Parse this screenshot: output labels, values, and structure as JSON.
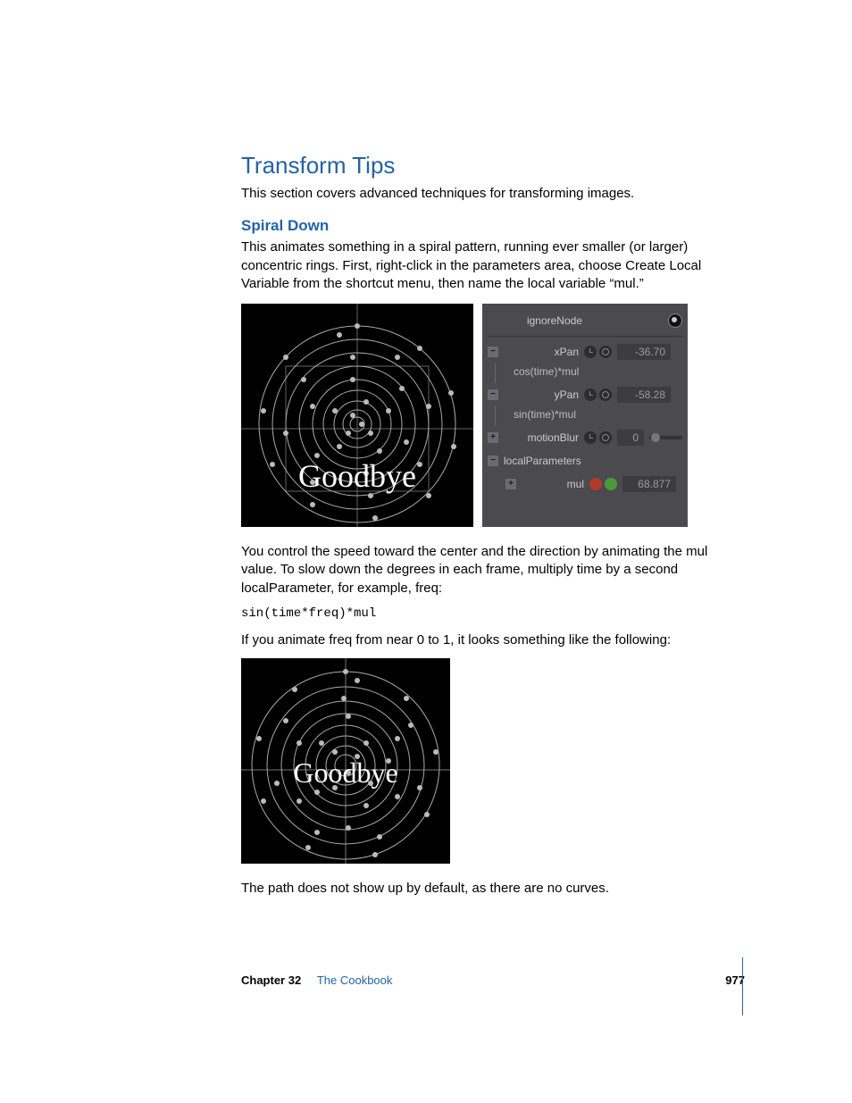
{
  "headings": {
    "section": "Transform Tips",
    "intro": "This section covers advanced techniques for transforming images.",
    "sub": "Spiral Down",
    "p1": "This animates something in a spiral pattern, running ever smaller (or larger) concentric rings. First, right-click in the parameters area, choose Create Local Variable from the shortcut menu, then name the local variable “mul.”"
  },
  "fig1_text": "Goodbye",
  "panel": {
    "ignoreNode": "ignoreNode",
    "xPan": {
      "label": "xPan",
      "value": "-36.70",
      "expr": "cos(time)*mul"
    },
    "yPan": {
      "label": "yPan",
      "value": "-58.28",
      "expr": "sin(time)*mul"
    },
    "motionBlur": {
      "label": "motionBlur",
      "value": "0"
    },
    "localParameters": "localParameters",
    "mul": {
      "label": "mul",
      "value": "68.877"
    }
  },
  "p2": "You control the speed toward the center and the direction by animating the mul value. To slow down the degrees in each frame, multiply time by a second localParameter, for example, freq:",
  "code": "sin(time*freq)*mul",
  "p3": "If you animate freq from near 0 to 1, it looks something like the following:",
  "fig2_text": "Goodbye",
  "p4": "The path does not show up by default, as there are no curves.",
  "footer": {
    "chapter": "Chapter 32",
    "title": "The Cookbook",
    "page": "977"
  }
}
